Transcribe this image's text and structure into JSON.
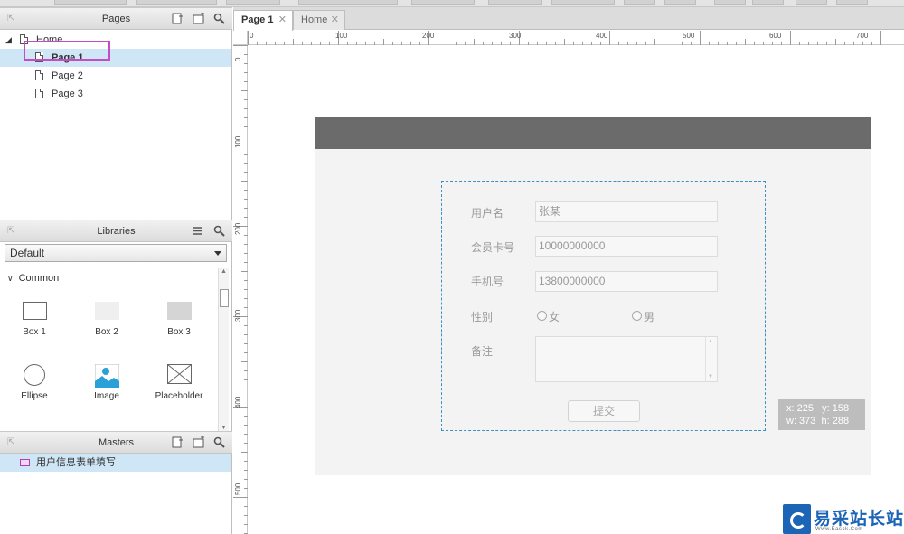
{
  "panels": {
    "pages": {
      "title": "Pages",
      "tree": [
        {
          "label": "Home",
          "level": 0
        },
        {
          "label": "Page 1",
          "level": 1,
          "selected": true
        },
        {
          "label": "Page 2",
          "level": 1
        },
        {
          "label": "Page 3",
          "level": 1
        }
      ]
    },
    "libraries": {
      "title": "Libraries",
      "selected_library": "Default",
      "group": "Common",
      "items": [
        "Box 1",
        "Box 2",
        "Box 3",
        "Ellipse",
        "Image",
        "Placeholder"
      ]
    },
    "masters": {
      "title": "Masters",
      "items": [
        "用户信息表单填写"
      ]
    }
  },
  "tabs": [
    {
      "label": "Page 1",
      "active": true
    },
    {
      "label": "Home",
      "active": false
    }
  ],
  "ruler": {
    "h": [
      "0",
      "100",
      "200",
      "300",
      "400",
      "500",
      "600",
      "700"
    ],
    "v": [
      "0",
      "100",
      "200",
      "300",
      "400",
      "500"
    ]
  },
  "form": {
    "username_label": "用户名",
    "username_value": "张某",
    "card_label": "会员卡号",
    "card_value": "10000000000",
    "phone_label": "手机号",
    "phone_value": "13800000000",
    "gender_label": "性别",
    "gender_female": "女",
    "gender_male": "男",
    "remark_label": "备注",
    "submit_label": "提交"
  },
  "tooltip": {
    "x": "x: 225",
    "y": "y: 158",
    "w": "w: 373",
    "h": "h: 288"
  },
  "watermark": {
    "text": "易采站长站",
    "sub": "Www.Easck.Com"
  },
  "colors": {
    "selection": "#cfe6f6",
    "highlight_box": "#c44dc4",
    "dashed_border": "#3d8fc2",
    "mock_header": "#6b6b6b",
    "brand_blue": "#1c64b5"
  }
}
